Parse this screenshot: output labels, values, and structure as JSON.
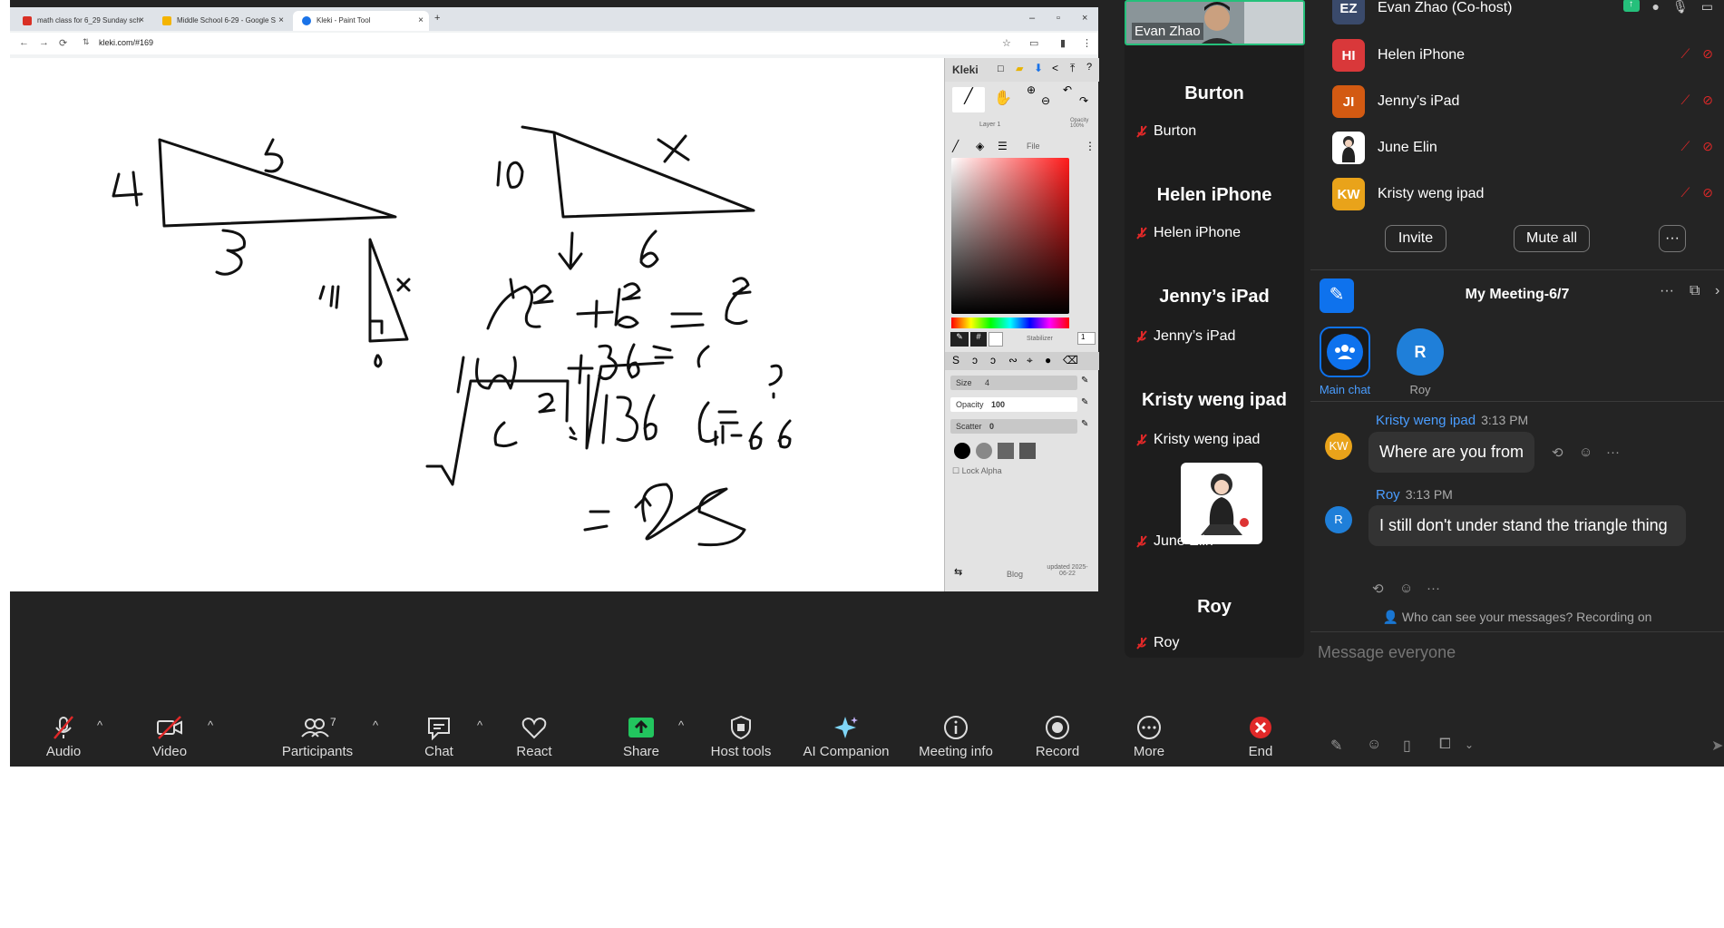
{
  "browser": {
    "tabs": [
      {
        "label": "math class for 6_29 Sunday sch",
        "color": "#d93025"
      },
      {
        "label": "Middle School 6-29 - Google S",
        "color": "#f4b400"
      },
      {
        "label": "Kleki - Paint Tool",
        "color": "#1a73e8"
      }
    ],
    "url": "kleki.com/#169"
  },
  "kleki": {
    "logo": "Kleki",
    "layer": "Layer 1",
    "opacity_small": "Opacity 100%",
    "file": "File",
    "stabilizer_label": "Stabilizer",
    "stabilizer_value": "1",
    "size_label": "Size",
    "size_value": "4",
    "opacity_label": "Opacity",
    "opacity_value": "100",
    "scatter_label": "Scatter",
    "scatter_value": "0",
    "lock_alpha": "Lock Alpha",
    "blog": "Blog",
    "updated": "updated 2025-06-22"
  },
  "self_video": {
    "name": "Evan Zhao"
  },
  "tiles": [
    {
      "title": "Burton",
      "label": "Burton"
    },
    {
      "title": "Helen iPhone",
      "label": "Helen iPhone"
    },
    {
      "title": "Jenny’s iPad",
      "label": "Jenny’s iPad"
    },
    {
      "title": "Kristy weng ipad",
      "label": "Kristy weng ipad"
    },
    {
      "title": "",
      "label": "June Elin"
    },
    {
      "title": "Roy",
      "label": "Roy"
    }
  ],
  "participants": [
    {
      "initials": "EZ",
      "name": "Evan Zhao (Co-host)",
      "color": "#3a4a6b"
    },
    {
      "initials": "HI",
      "name": "Helen iPhone",
      "color": "#d9383a"
    },
    {
      "initials": "JI",
      "name": "Jenny’s iPad",
      "color": "#d35a12"
    },
    {
      "initials": "",
      "name": "June Elin",
      "color": "#ffffff"
    },
    {
      "initials": "KW",
      "name": "Kristy weng ipad",
      "color": "#e9a31a"
    }
  ],
  "participant_buttons": {
    "invite": "Invite",
    "mute_all": "Mute all",
    "more": "···"
  },
  "chat": {
    "title": "My Meeting-6/7",
    "channels": [
      {
        "label": "Main chat"
      },
      {
        "initial": "R",
        "label": "Roy"
      }
    ],
    "messages": [
      {
        "avatar": "KW",
        "sender": "Kristy weng ipad",
        "time": "3:13 PM",
        "text": "Where are you from"
      },
      {
        "avatar": "R",
        "sender": "Roy",
        "time": "3:13 PM",
        "text": "I still don't under stand the triangle thing"
      }
    ],
    "notice": "Who can see your messages? Recording on",
    "placeholder": "Message everyone"
  },
  "toolbar": {
    "audio": "Audio",
    "video": "Video",
    "participants": "Participants",
    "participants_count": "7",
    "chat": "Chat",
    "react": "React",
    "share": "Share",
    "host_tools": "Host tools",
    "ai_companion": "AI Companion",
    "meeting_info": "Meeting info",
    "record": "Record",
    "more": "More",
    "end": "End"
  },
  "colors": {
    "accent": "#0e72ed",
    "share_green": "#22c55e",
    "end_red": "#e02828",
    "active_border": "#25c07b"
  }
}
